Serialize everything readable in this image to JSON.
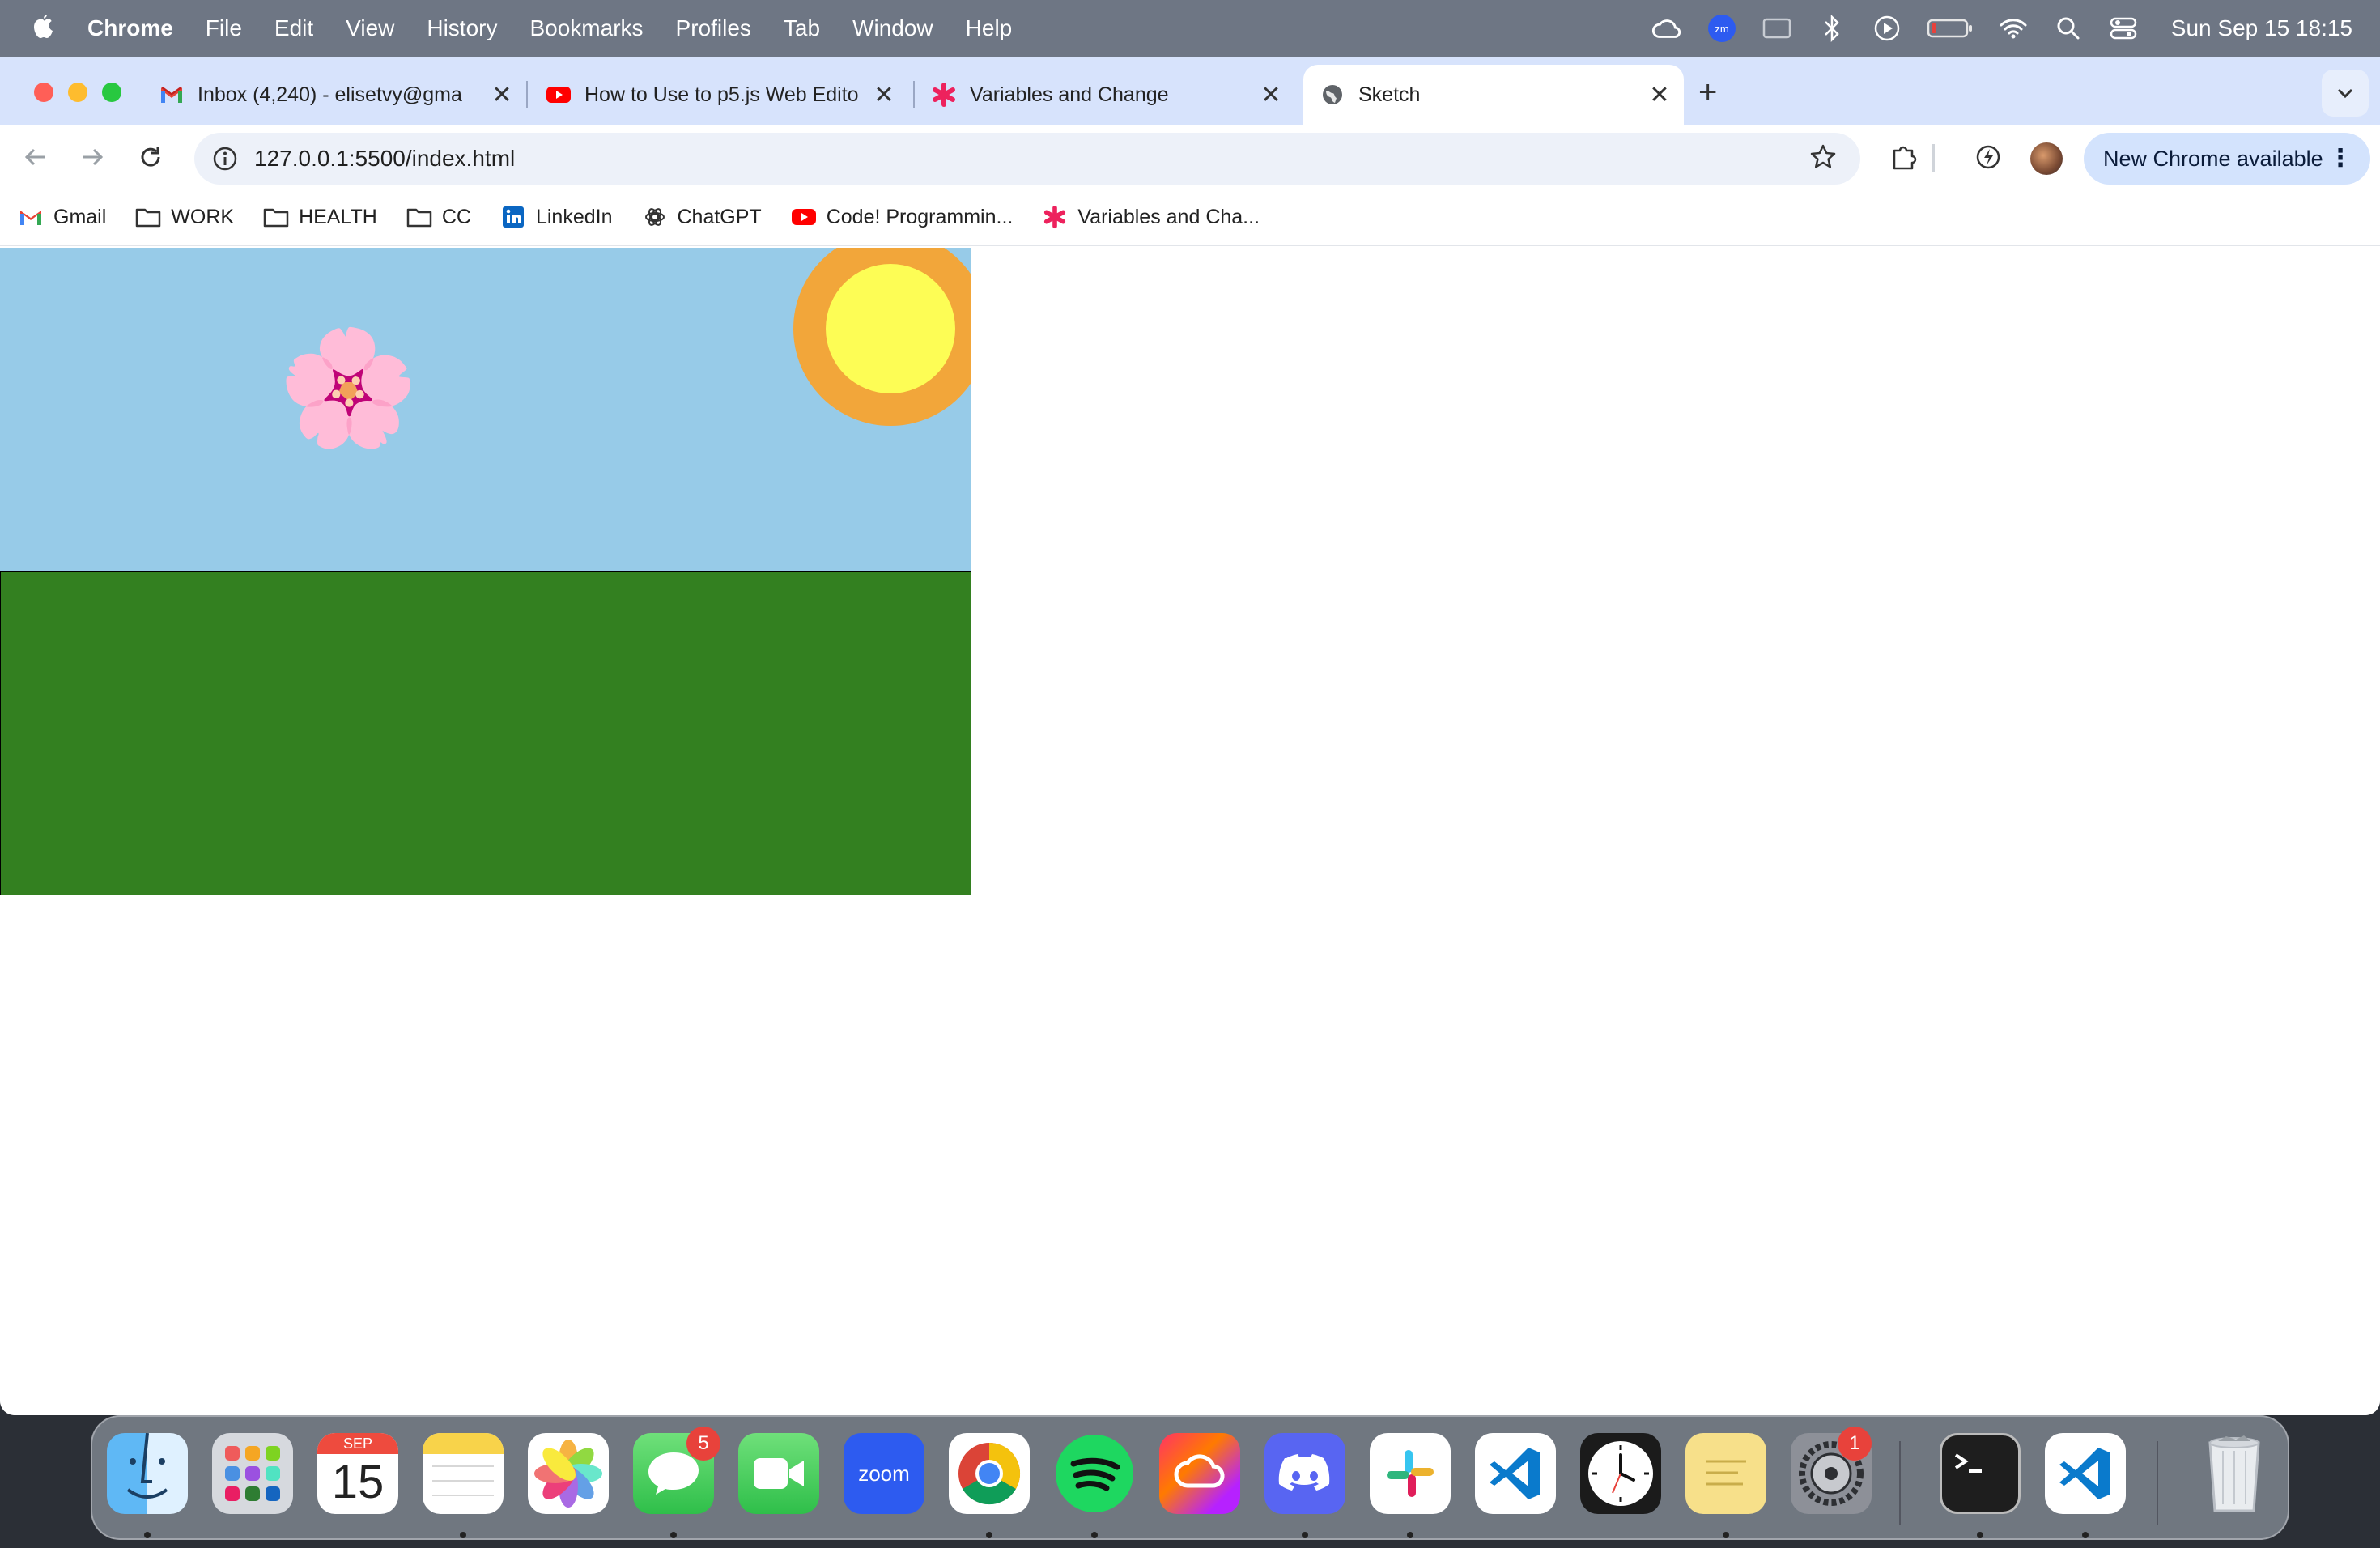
{
  "menubar": {
    "app_name": "Chrome",
    "items": [
      "File",
      "Edit",
      "View",
      "History",
      "Bookmarks",
      "Profiles",
      "Tab",
      "Window",
      "Help"
    ],
    "clock": "Sun Sep 15  18:15"
  },
  "tabs": [
    {
      "title": "Inbox (4,240) - elisetvy@gma",
      "favicon": "gmail-icon"
    },
    {
      "title": "How to Use to p5.js Web Edito",
      "favicon": "youtube-icon"
    },
    {
      "title": "Variables and Change",
      "favicon": "p5-asterisk-icon"
    },
    {
      "title": "Sketch",
      "favicon": "globe-icon",
      "active": true
    }
  ],
  "toolbar": {
    "url": "127.0.0.1:5500/index.html",
    "update_label": "New Chrome available"
  },
  "bookmarks": [
    {
      "label": "Gmail",
      "icon": "gmail-icon"
    },
    {
      "label": "WORK",
      "icon": "folder-icon"
    },
    {
      "label": "HEALTH",
      "icon": "folder-icon"
    },
    {
      "label": "CC",
      "icon": "folder-icon"
    },
    {
      "label": "LinkedIn",
      "icon": "linkedin-icon"
    },
    {
      "label": "ChatGPT",
      "icon": "chatgpt-icon"
    },
    {
      "label": "Code! Programmin...",
      "icon": "youtube-icon"
    },
    {
      "label": "Variables and Cha...",
      "icon": "p5-asterisk-icon"
    }
  ],
  "sketch": {
    "sky_color": "#97cbe8",
    "ground_color": "#338020",
    "sun_outer_color": "#f2a63a",
    "sun_inner_color": "#fdfd55",
    "flower_emoji": "🌸"
  },
  "dock": {
    "calendar_month": "SEP",
    "calendar_day": "15",
    "messages_badge": "5",
    "settings_badge": "1",
    "zoom_label": "zoom"
  }
}
